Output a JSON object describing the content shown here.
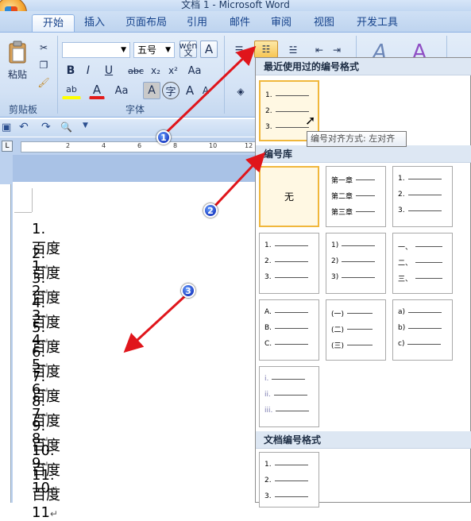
{
  "window": {
    "title": "文档 1 - Microsoft Word"
  },
  "tabs": [
    {
      "label": "开始"
    },
    {
      "label": "插入"
    },
    {
      "label": "页面布局"
    },
    {
      "label": "引用"
    },
    {
      "label": "邮件"
    },
    {
      "label": "审阅"
    },
    {
      "label": "视图"
    },
    {
      "label": "开发工具"
    }
  ],
  "clipboard": {
    "paste_label": "粘贴",
    "group_label": "剪贴板"
  },
  "font": {
    "size_value": "五号",
    "wen_label": "wén\n文",
    "group_label": "字体",
    "bold": "B",
    "italic": "I",
    "underline": "U",
    "strike": "abc",
    "sub": "x₂",
    "sup": "x²",
    "aa": "Aa",
    "highlight": "ab",
    "color": "A",
    "grow": "A",
    "shrink": "A",
    "charbox": "A",
    "phonetic": "字"
  },
  "gallery": {
    "recent_header": "最近使用过的编号格式",
    "library_header": "编号库",
    "document_header": "文档编号格式",
    "none_label": "无",
    "recent": [
      [
        "1.",
        "2.",
        "3."
      ]
    ],
    "library": [
      [
        "第一章",
        "第二章",
        "第三章"
      ],
      [
        "1.",
        "2.",
        "3."
      ],
      [
        "1.",
        "2.",
        "3."
      ],
      [
        "1)",
        "2)",
        "3)"
      ],
      [
        "一、",
        "二、",
        "三、"
      ],
      [
        "A.",
        "B.",
        "C."
      ],
      [
        "(一)",
        "(二)",
        "(三)"
      ],
      [
        "a)",
        "b)",
        "c)"
      ],
      [
        "i.",
        "ii.",
        "iii."
      ]
    ],
    "document": [
      [
        "1.",
        "2.",
        "3."
      ]
    ],
    "tooltip": "编号对齐方式: 左对齐"
  },
  "ruler": {
    "ticks": [
      "2",
      "4",
      "6",
      "8",
      "10",
      "12"
    ]
  },
  "document": {
    "list_items": [
      {
        "num": "1.",
        "text": "百度 1",
        "mark": "↵"
      },
      {
        "num": "2.",
        "text": "百度 2",
        "mark": "↵"
      },
      {
        "num": "3.",
        "text": "百度 3",
        "mark": "↵"
      },
      {
        "num": "4.",
        "text": "百度 4",
        "mark": "↵"
      },
      {
        "num": "5.",
        "text": "百度 5",
        "mark": "↵"
      },
      {
        "num": "6.",
        "text": "百度 6",
        "mark": "↵"
      },
      {
        "num": "7.",
        "text": "百度 7",
        "mark": "↵"
      },
      {
        "num": "8.",
        "text": "百度 8",
        "mark": "↵"
      },
      {
        "num": "9.",
        "text": "百度 9",
        "mark": "↵"
      },
      {
        "num": "10.",
        "text": "百度 10",
        "mark": "↵"
      },
      {
        "num": "11.",
        "text": "百度 11",
        "mark": "↵"
      }
    ]
  },
  "annotations": [
    {
      "label": "1"
    },
    {
      "label": "2"
    },
    {
      "label": "3"
    }
  ],
  "colors": {
    "arrow": "#e0151b",
    "ribbon": "#d3e2f5",
    "selected": "#f0b73c"
  }
}
